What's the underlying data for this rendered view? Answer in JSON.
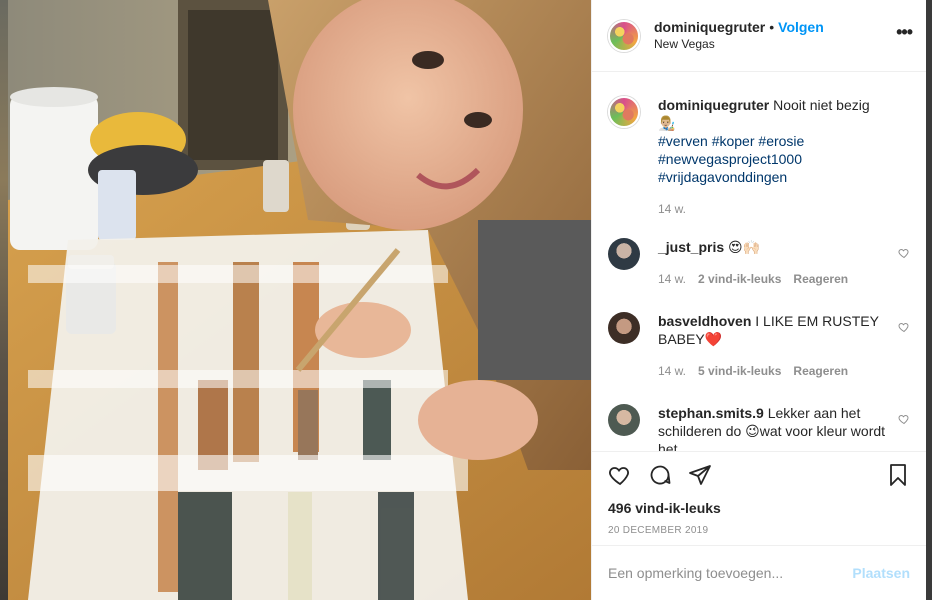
{
  "post": {
    "username": "dominiquegruter",
    "separator": "•",
    "follow_label": "Volgen",
    "location": "New Vegas",
    "more_label": "•••"
  },
  "caption": {
    "username": "dominiquegruter",
    "text": "Nooit niet bezig 👨🏼‍🎨",
    "hashtags": [
      "#verven",
      "#koper",
      "#erosie",
      "#newvegasproject1000",
      "#vrijdagavonddingen"
    ],
    "time": "14 w."
  },
  "comments": [
    {
      "username": "_just_pris",
      "text": "😍🙌🏻",
      "time": "14 w.",
      "likes": "2 vind-ik-leuks",
      "reply": "Reageren"
    },
    {
      "username": "basveldhoven",
      "text": "I LIKE EM RUSTEY BABEY❤️",
      "time": "14 w.",
      "likes": "5 vind-ik-leuks",
      "reply": "Reageren"
    },
    {
      "username": "stephan.smits.9",
      "text": "Lekker aan het schilderen do 😉wat voor kleur wordt het",
      "time": "",
      "likes": "",
      "reply": ""
    }
  ],
  "actions": {
    "likes": "496 vind-ik-leuks",
    "date": "20 DECEMBER 2019"
  },
  "add_comment": {
    "placeholder": "Een opmerking toevoegen...",
    "post_label": "Plaatsen"
  },
  "colors": {
    "accent": "#0095f6",
    "hashtag": "#00376b",
    "muted": "#8e8e8e",
    "post_disabled": "#b2dffc"
  }
}
